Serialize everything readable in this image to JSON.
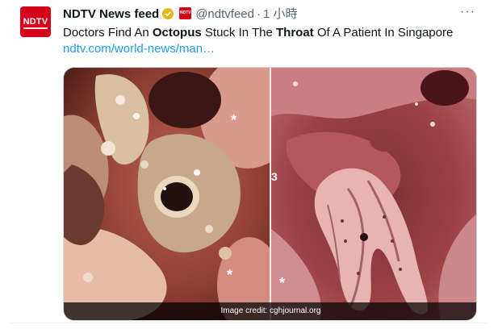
{
  "tweet": {
    "avatar_text": "NDTV",
    "display_name": "NDTV News feed",
    "handle": "@ndtvfeed",
    "separator": "·",
    "time": "1 小時",
    "more_icon": "more-icon",
    "text_parts": {
      "p1": "Doctors Find An ",
      "b1": "Octopus",
      "p2": " Stuck In The ",
      "b2": "Throat",
      "p3": " Of A Patient In Singapore"
    },
    "link": "ndtv.com/world-news/man…",
    "mini_logo_text": "NDTV"
  },
  "media": {
    "left_marker_top": "*",
    "left_marker_bottom": "*",
    "right_marker_number": "3",
    "right_marker_bottom": "*",
    "credit": "Image credit: cghjournal.org"
  },
  "colors": {
    "brand_red": "#d6001c",
    "link_blue": "#1d9bf0",
    "verified_gold": "#e2b719",
    "secondary_text": "#536471"
  }
}
